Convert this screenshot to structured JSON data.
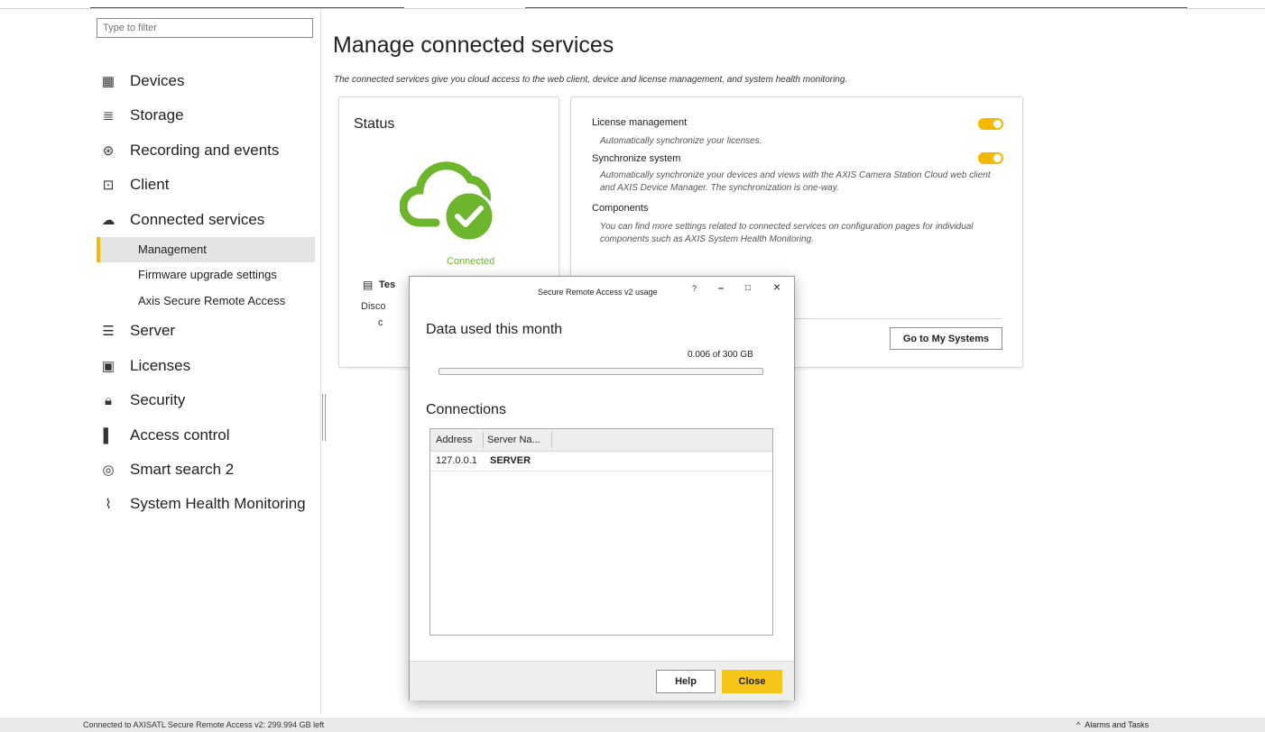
{
  "sidebar": {
    "filter_placeholder": "Type to filter",
    "items": [
      {
        "label": "Devices",
        "icon": "devices-icon"
      },
      {
        "label": "Storage",
        "icon": "storage-icon"
      },
      {
        "label": "Recording and events",
        "icon": "recording-icon"
      },
      {
        "label": "Client",
        "icon": "client-icon"
      },
      {
        "label": "Connected services",
        "icon": "cloud-icon"
      },
      {
        "label": "Server",
        "icon": "server-icon"
      },
      {
        "label": "Licenses",
        "icon": "licenses-icon"
      },
      {
        "label": "Security",
        "icon": "lock-icon"
      },
      {
        "label": "Access control",
        "icon": "door-icon"
      },
      {
        "label": "Smart search 2",
        "icon": "smart-search-icon"
      },
      {
        "label": "System Health Monitoring",
        "icon": "pulse-icon"
      }
    ],
    "subitems": [
      "Management",
      "Firmware upgrade settings",
      "Axis Secure Remote Access"
    ]
  },
  "main": {
    "title": "Manage connected services",
    "description": "The connected services give you cloud access to the web client, device and license management, and system health monitoring.",
    "status_card": {
      "title": "Status",
      "state": "Connected",
      "test_label": "Tes",
      "disconnect_label": "Disco",
      "o_label": "c"
    },
    "settings": {
      "license_label": "License management",
      "license_desc": "Automatically synchronize your licenses.",
      "license_on": true,
      "sync_label": "Synchronize system",
      "sync_desc": "Automatically synchronize your devices and views with the AXIS Camera Station Cloud web client and AXIS Device Manager. The synchronization is one-way.",
      "sync_on": true,
      "components_label": "Components",
      "components_desc": "You can find more settings related to connected services on configuration pages for individual components such as AXIS System Health Monitoring.",
      "go_button": "Go to My Systems"
    }
  },
  "dialog": {
    "title": "Secure Remote Access v2 usage",
    "help_glyph": "?",
    "minimize_glyph": "–",
    "maximize_glyph": "□",
    "close_glyph": "×",
    "data_heading": "Data used this month",
    "usage_text": "0.006 of 300 GB",
    "usage_fraction": 2e-05,
    "connections_heading": "Connections",
    "columns": [
      "Address",
      "Server Na..."
    ],
    "rows": [
      {
        "address": "127.0.0.1",
        "server": "SERVER"
      }
    ],
    "help_button": "Help",
    "close_button": "Close"
  },
  "statusbar": {
    "left": "Connected to AXISATL  Secure Remote Access v2: 299.994 GB left",
    "right": "Alarms and Tasks",
    "right_icon": "^"
  },
  "colors": {
    "accent": "#f5b800",
    "connected_green": "#6cb52d"
  }
}
